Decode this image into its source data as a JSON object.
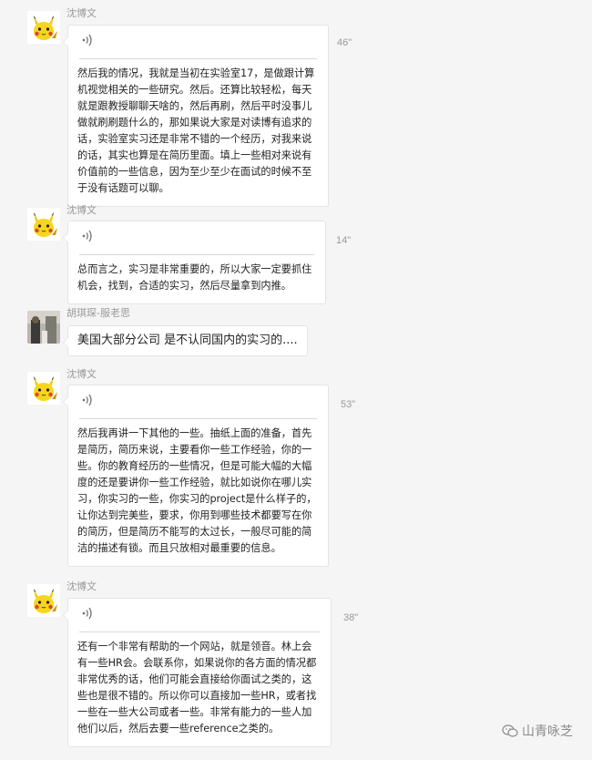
{
  "messages": [
    {
      "sender": "沈博文",
      "avatar": "pikachu-avatar",
      "type": "voice",
      "duration": "46\"",
      "transcript": "然后我的情况，我就是当初在实验室17，是做跟计算机视觉相关的一些研究。然后。还算比较轻松，每天就是跟教授聊聊天啥的，然后再刷，然后平时没事儿做就刷刷题什么的，那如果说大家是对读博有追求的话，实验室实习还是非常不错的一个经历，对我来说的话，其实也算是在简历里面。填上一些相对来说有价值前的一些信息，因为至少至少在面试的时候不至于没有话题可以聊。"
    },
    {
      "sender": "沈博文",
      "avatar": "pikachu-avatar",
      "type": "voice",
      "duration": "14\"",
      "transcript": "总而言之，实习是非常重要的，所以大家一定要抓住机会，找到，合适的实习，然后尽量拿到内推。"
    },
    {
      "sender": "胡琪琛-服老思",
      "avatar": "photo-avatar",
      "type": "text",
      "text": "美国大部分公司 是不认同国内的实习的...."
    },
    {
      "sender": "沈博文",
      "avatar": "pikachu-avatar",
      "type": "voice",
      "duration": "53\"",
      "transcript": "然后我再讲一下其他的一些。抽纸上面的准备，首先是简历，简历来说，主要看你一些工作经验，你的一些。你的教育经历的一些情况，但是可能大幅的大幅度的还是要讲你一些工作经验，就比如说你在哪儿实习，你实习的一些，你实习的project是什么样子的，让你达到完美些，要求，你用到哪些技术都要写在你的简历，但是简历不能写的太过长，一般尽可能的简洁的描述有锁。而且只放相对最重要的信息。"
    },
    {
      "sender": "沈博文",
      "avatar": "pikachu-avatar",
      "type": "voice",
      "duration": "38\"",
      "transcript": "还有一个非常有帮助的一个网站，就是领音。林上会有一些HR会。会联系你，如果说你的各方面的情况都非常优秀的话，他们可能会直接给你面试之类的，这些也是很不错的。所以你可以直接加一些HR，或者找一些在一些大公司或者一些。非常有能力的一些人加他们以后，然后去要一些reference之类的。"
    }
  ],
  "watermark": "山青咏芝",
  "colors": {
    "bubble": "#ffffff",
    "background": "#f5f5f5",
    "muted": "#999999"
  }
}
